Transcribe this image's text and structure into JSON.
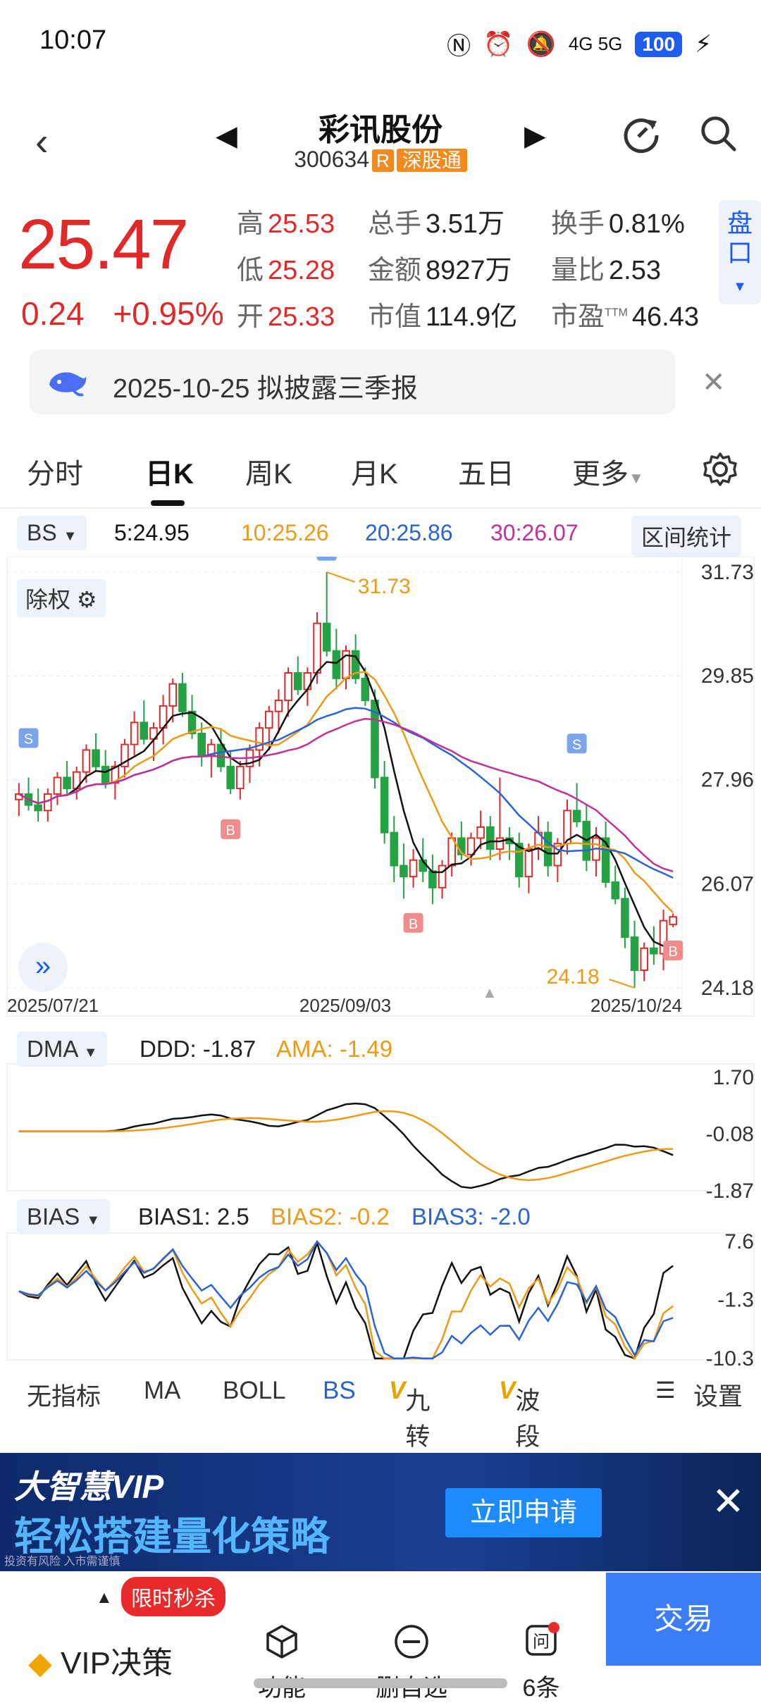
{
  "status_bar": {
    "time": "10:07",
    "network": "4G 5G",
    "battery": "100"
  },
  "header": {
    "title": "彩讯股份",
    "code": "300634",
    "r_badge": "R",
    "connect_badge": "深股通"
  },
  "quote": {
    "price": "25.47",
    "change": "0.24",
    "change_pct": "+0.95%",
    "high_label": "高",
    "high": "25.53",
    "low_label": "低",
    "low": "25.28",
    "open_label": "开",
    "open": "25.33",
    "volume_label": "总手",
    "volume": "3.51万",
    "amount_label": "金额",
    "amount": "8927万",
    "mktcap_label": "市值",
    "mktcap": "114.9亿",
    "turnover_label": "换手",
    "turnover": "0.81%",
    "volratio_label": "量比",
    "volratio": "2.53",
    "pe_label": "市盈",
    "pe_sup": "TTM",
    "pe": "46.43",
    "pankou_label": "盘口"
  },
  "notice": {
    "text": "2025-10-25 拟披露三季报"
  },
  "tabs": [
    "分时",
    "日K",
    "周K",
    "月K",
    "五日",
    "更多"
  ],
  "ma_legend": {
    "bs_label": "BS",
    "ma5": "5:24.95",
    "ma10": "10:25.26",
    "ma20": "20:25.86",
    "ma30": "30:26.07",
    "range_stats": "区间统计"
  },
  "kline": {
    "adjust_label": "除权",
    "max_label": "31.73",
    "min_label": "24.18",
    "y_ticks": [
      "31.73",
      "29.85",
      "27.96",
      "26.07",
      "24.18"
    ],
    "dates": [
      "2025/07/21",
      "2025/09/03",
      "2025/10/24"
    ],
    "signal_s": "S",
    "signal_b": "B"
  },
  "dma": {
    "selector": "DMA",
    "ddd": "DDD: -1.87",
    "ama": "AMA: -1.49",
    "ticks": [
      "1.70",
      "-0.08",
      "-1.87"
    ]
  },
  "bias": {
    "selector": "BIAS",
    "b1": "BIAS1: 2.5",
    "b2": "BIAS2: -0.2",
    "b3": "BIAS3: -2.0",
    "ticks": [
      "7.6",
      "-1.3",
      "-10.3"
    ]
  },
  "indicator_tabs": [
    "无指标",
    "MA",
    "BOLL",
    "BS",
    "九转",
    "波段王",
    "设置"
  ],
  "banner": {
    "brand": "大智慧VIP",
    "headline": "轻松搭建量化策略",
    "cta": "立即申请",
    "disclaimer": "投资有风险 入市需谨慎"
  },
  "bottom_bar": {
    "promo": "限时秒杀",
    "vip": "VIP决策",
    "func": "功能",
    "delete": "删自选",
    "ask": "6条",
    "trade": "交易"
  },
  "colors": {
    "up": "#e02a2a",
    "down": "#25a244",
    "ma5": "#111111",
    "ma10": "#ef9a17",
    "ma20": "#2a63d6",
    "ma30": "#c2319a",
    "accent": "#1e5cf0"
  },
  "chart_data": {
    "type": "candlestick",
    "x_labels": [
      "2025/07/21",
      "2025/09/03",
      "2025/10/24"
    ],
    "ylim": [
      24.18,
      31.73
    ],
    "candles": [
      [
        27.6,
        27.9,
        27.3,
        27.7
      ],
      [
        27.7,
        28.0,
        27.4,
        27.5
      ],
      [
        27.5,
        27.8,
        27.2,
        27.4
      ],
      [
        27.4,
        27.8,
        27.2,
        27.7
      ],
      [
        27.7,
        28.1,
        27.5,
        28.0
      ],
      [
        28.0,
        28.3,
        27.7,
        27.8
      ],
      [
        27.8,
        28.2,
        27.6,
        28.1
      ],
      [
        28.1,
        28.6,
        27.9,
        28.5
      ],
      [
        28.5,
        28.8,
        28.1,
        28.2
      ],
      [
        28.2,
        28.5,
        27.8,
        27.9
      ],
      [
        27.9,
        28.3,
        27.6,
        28.2
      ],
      [
        28.2,
        28.7,
        28.0,
        28.6
      ],
      [
        28.6,
        29.2,
        28.4,
        29.0
      ],
      [
        29.0,
        29.4,
        28.6,
        28.7
      ],
      [
        28.7,
        29.0,
        28.3,
        28.9
      ],
      [
        28.9,
        29.5,
        28.6,
        29.3
      ],
      [
        29.3,
        29.8,
        29.0,
        29.7
      ],
      [
        29.7,
        29.9,
        29.1,
        29.2
      ],
      [
        29.2,
        29.5,
        28.7,
        28.8
      ],
      [
        28.8,
        29.0,
        28.2,
        28.4
      ],
      [
        28.4,
        28.7,
        28.0,
        28.6
      ],
      [
        28.6,
        28.9,
        28.1,
        28.2
      ],
      [
        28.2,
        28.5,
        27.7,
        27.8
      ],
      [
        27.8,
        28.3,
        27.6,
        28.2
      ],
      [
        28.2,
        28.6,
        27.9,
        28.5
      ],
      [
        28.5,
        29.0,
        28.2,
        28.9
      ],
      [
        28.9,
        29.3,
        28.5,
        29.2
      ],
      [
        29.2,
        29.6,
        28.8,
        29.4
      ],
      [
        29.4,
        30.0,
        29.1,
        29.9
      ],
      [
        29.9,
        30.2,
        29.5,
        29.6
      ],
      [
        29.6,
        30.0,
        29.3,
        29.9
      ],
      [
        29.9,
        31.0,
        29.7,
        30.8
      ],
      [
        30.8,
        31.73,
        30.2,
        30.3
      ],
      [
        30.3,
        30.7,
        29.6,
        29.8
      ],
      [
        29.8,
        30.4,
        29.6,
        30.3
      ],
      [
        30.3,
        30.6,
        29.7,
        29.8
      ],
      [
        29.8,
        30.0,
        29.3,
        29.4
      ],
      [
        29.4,
        29.6,
        27.8,
        28.0
      ],
      [
        28.0,
        28.3,
        26.8,
        27.0
      ],
      [
        27.0,
        27.3,
        26.1,
        26.4
      ],
      [
        26.4,
        26.8,
        25.8,
        26.2
      ],
      [
        26.2,
        26.7,
        26.0,
        26.5
      ],
      [
        26.5,
        26.9,
        26.1,
        26.3
      ],
      [
        26.3,
        26.6,
        25.7,
        26.0
      ],
      [
        26.0,
        26.5,
        25.8,
        26.4
      ],
      [
        26.4,
        27.0,
        26.2,
        26.9
      ],
      [
        26.9,
        27.2,
        26.5,
        26.6
      ],
      [
        26.6,
        27.0,
        26.4,
        26.9
      ],
      [
        26.9,
        27.4,
        26.7,
        27.1
      ],
      [
        27.1,
        27.3,
        26.5,
        26.7
      ],
      [
        26.7,
        28.0,
        26.5,
        26.9
      ],
      [
        26.9,
        27.1,
        26.5,
        26.8
      ],
      [
        26.8,
        27.0,
        26.0,
        26.2
      ],
      [
        26.2,
        26.8,
        25.9,
        26.7
      ],
      [
        26.7,
        27.3,
        26.5,
        27.0
      ],
      [
        27.0,
        27.2,
        26.2,
        26.4
      ],
      [
        26.4,
        26.9,
        26.1,
        26.8
      ],
      [
        26.8,
        27.6,
        26.6,
        27.4
      ],
      [
        27.4,
        27.9,
        27.1,
        27.2
      ],
      [
        27.2,
        27.5,
        26.3,
        26.5
      ],
      [
        26.5,
        27.1,
        26.2,
        26.9
      ],
      [
        26.9,
        27.2,
        26.0,
        26.1
      ],
      [
        26.1,
        26.4,
        25.7,
        25.8
      ],
      [
        25.8,
        26.0,
        24.9,
        25.1
      ],
      [
        25.1,
        25.4,
        24.18,
        24.5
      ],
      [
        24.5,
        25.0,
        24.3,
        24.9
      ],
      [
        24.9,
        25.3,
        24.6,
        24.8
      ],
      [
        24.8,
        25.6,
        24.5,
        25.4
      ],
      [
        25.33,
        25.53,
        25.28,
        25.47
      ]
    ]
  }
}
